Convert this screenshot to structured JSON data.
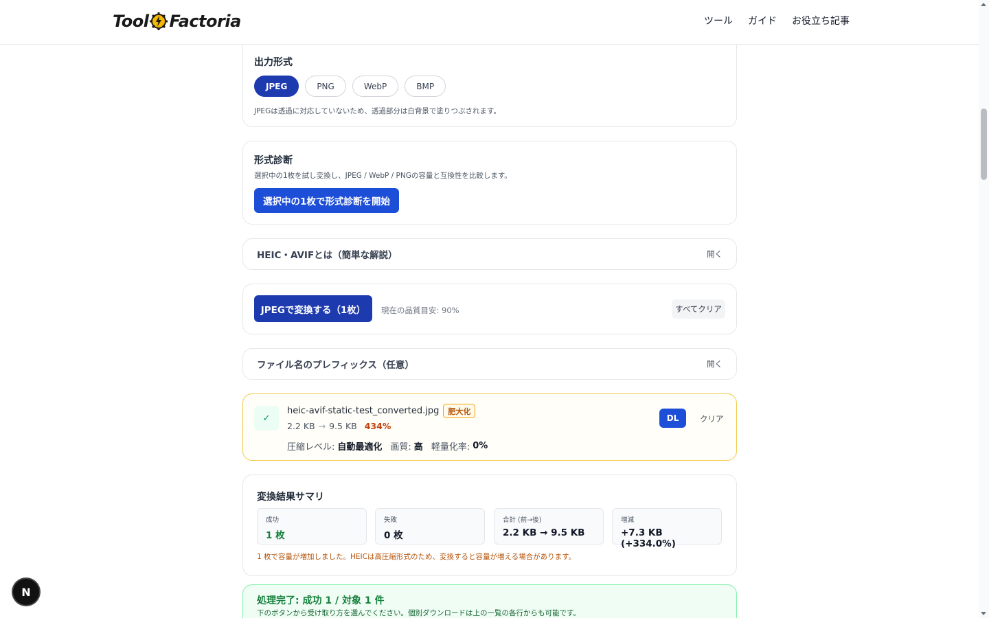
{
  "header": {
    "logo_left": "Tool",
    "logo_right": "Factoria",
    "nav": [
      "ツール",
      "ガイド",
      "お役立ち記事"
    ]
  },
  "output_format": {
    "title": "出力形式",
    "options": [
      "JPEG",
      "PNG",
      "WebP",
      "BMP"
    ],
    "selected": "JPEG",
    "note": "JPEGは透過に対応していないため、透過部分は白背景で塗りつぶされます。"
  },
  "diagnosis": {
    "title": "形式診断",
    "description": "選択中の1枚を試し変換し、JPEG / WebP / PNGの容量と互換性を比較します。",
    "button": "選択中の1枚で形式診断を開始"
  },
  "heic_info": {
    "label": "HEIC・AVIFとは（簡単な解説）",
    "toggle": "開く"
  },
  "convert": {
    "button": "JPEGで変換する（1枚）",
    "quality_text": "現在の品質目安: 90%",
    "clear_all": "すべてクリア"
  },
  "prefix": {
    "label": "ファイル名のプレフィックス（任意）",
    "toggle": "開く"
  },
  "file_item": {
    "check": "✓",
    "filename": "heic-avif-static-test_converted.jpg",
    "badge": "肥大化",
    "size_before": "2.2 KB",
    "arrow": "→",
    "size_after": "9.5 KB",
    "percent": "434%",
    "compression_label": "圧縮レベル:",
    "compression_value": "自動最適化",
    "quality_label": "画質:",
    "quality_value": "高",
    "reduction_label": "軽量化率:",
    "reduction_value": "0%",
    "dl_button": "DL",
    "clear_button": "クリア"
  },
  "summary": {
    "title": "変換結果サマリ",
    "stats": [
      {
        "label": "成功",
        "value": "1 枚"
      },
      {
        "label": "失敗",
        "value": "0 枚"
      },
      {
        "label": "合計 (前→後)",
        "value": "2.2 KB → 9.5 KB"
      },
      {
        "label": "増減",
        "value": "+7.3 KB (+334.0%)"
      }
    ],
    "warning": "1 枚で容量が増加しました。HEICは高圧縮形式のため、変換すると容量が増える場合があります。"
  },
  "done": {
    "title": "処理完了: 成功 1 / 対象 1 件",
    "description": "下のボタンから受け取り方を選んでください。個別ダウンロードは上の一覧の各行からも可能です。"
  },
  "dev_badge": "N",
  "colors": {
    "primary": "#1e3aaf",
    "button_blue": "#1d4ed8",
    "success_green": "#15803d",
    "warning_orange": "#b45309",
    "warning_border": "#f2c94c"
  }
}
